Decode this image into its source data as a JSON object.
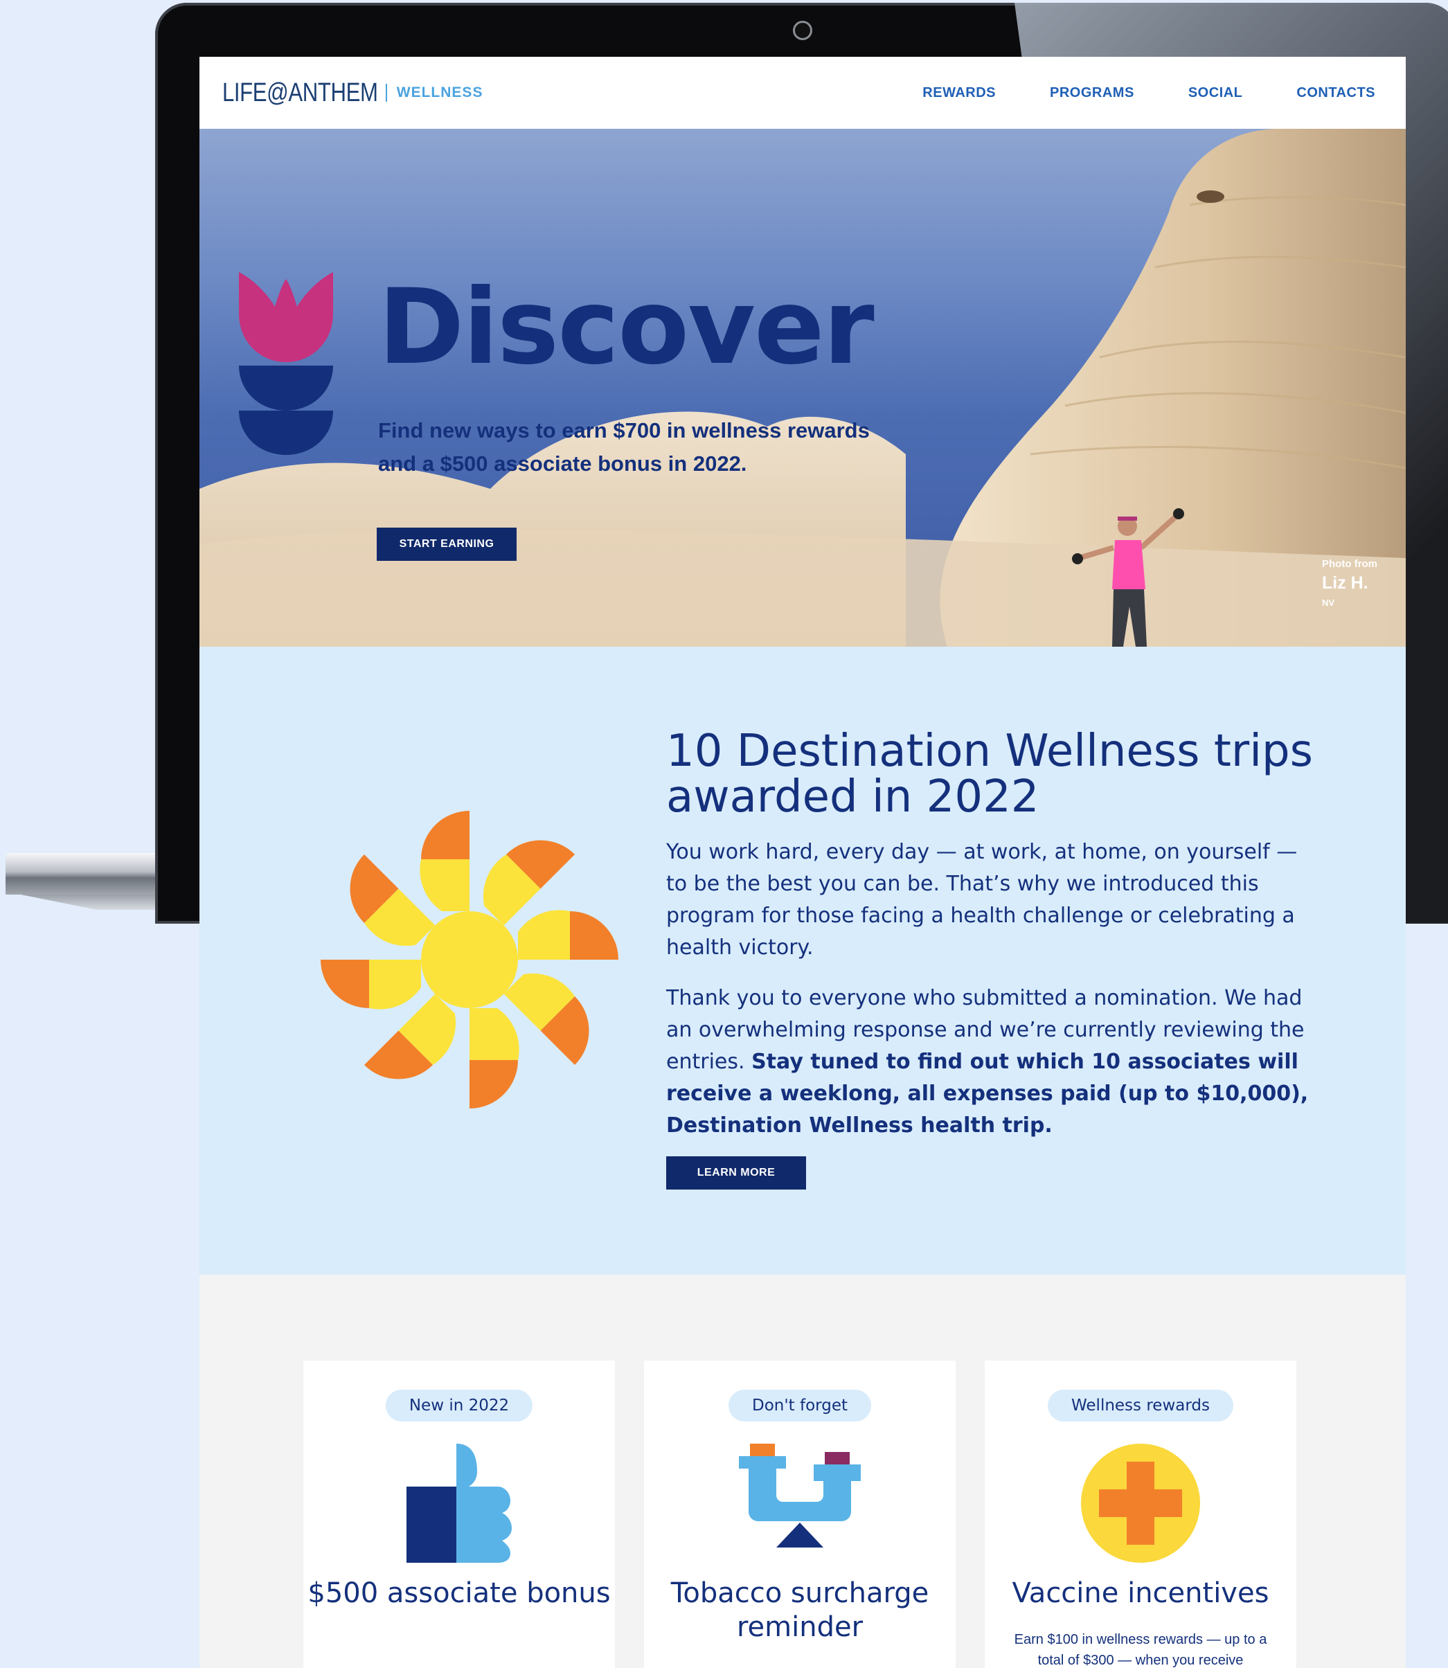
{
  "nav": {
    "logo_main": "LIFE@ANTHEM",
    "logo_sub": "WELLNESS",
    "links": [
      "REWARDS",
      "PROGRAMS",
      "SOCIAL",
      "CONTACTS"
    ]
  },
  "hero": {
    "title": "Discover",
    "subtitle": "Find new ways to earn $700 in wellness rewards and a $500 associate bonus in 2022.",
    "button": "START EARNING",
    "photo_credit": {
      "from": "Photo from",
      "name": "Liz H.",
      "location": "NV"
    }
  },
  "destination": {
    "title": "10 Destination Wellness trips awarded in 2022",
    "paragraph1": "You work hard, every day — at work, at home, on yourself — to be the best you can be. That’s why we introduced this program for those facing a health challenge or celebrating a health victory.",
    "paragraph2_plain": "Thank you to everyone who submitted a nomination. We had an overwhelming response and we’re currently reviewing the entries.",
    "paragraph2_bold": "Stay tuned to find out which 10 associates will receive a weeklong, all expenses paid (up to $10,000), Destination Wellness health trip.",
    "button": "LEARN MORE"
  },
  "cards": [
    {
      "pill": "New in 2022",
      "icon": "thumbs-up-icon",
      "title": "$500 associate bonus",
      "body": ""
    },
    {
      "pill": "Don't forget",
      "icon": "balance-scale-icon",
      "title": "Tobacco surcharge reminder",
      "body": ""
    },
    {
      "pill": "Wellness rewards",
      "icon": "medical-cross-icon",
      "title": "Vaccine incentives",
      "body": "Earn $100 in wellness rewards — up to a total of $300 — when you receive"
    }
  ],
  "colors": {
    "navy": "#14307c",
    "button": "#10296b",
    "accent_blue": "#4aa3df",
    "light_blue_bg": "#d9ecfb",
    "magenta": "#c6327d",
    "orange": "#f2802a",
    "yellow": "#fbe33b"
  }
}
